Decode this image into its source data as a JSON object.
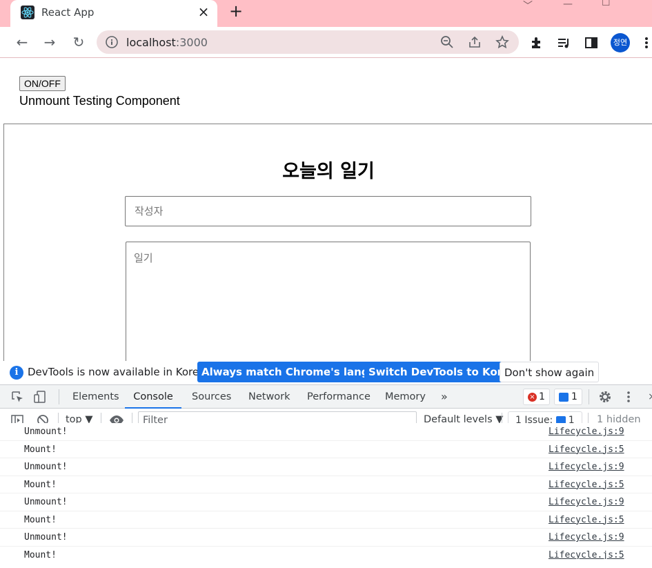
{
  "browser": {
    "tab_title": "React App",
    "url_host": "localhost",
    "url_port": ":3000",
    "profile_initials": "정연"
  },
  "page": {
    "toggle_button": "ON/OFF",
    "unmount_text": "Unmount Testing Component",
    "diary_title": "오늘의 일기",
    "author_placeholder": "작성자",
    "content_placeholder": "일기"
  },
  "infobar": {
    "message": "DevTools is now available in Korean!",
    "btn_match": "Always match Chrome's language",
    "btn_switch": "Switch DevTools to Korean",
    "btn_dismiss": "Don't show again"
  },
  "devtools": {
    "tabs": [
      "Elements",
      "Console",
      "Sources",
      "Network",
      "Performance",
      "Memory"
    ],
    "active_tab": "Console",
    "error_count": "1",
    "message_count": "1",
    "context": "top",
    "filter_placeholder": "Filter",
    "levels": "Default levels",
    "issues": "1 Issue:",
    "issues_count": "1",
    "hidden": "1 hidden"
  },
  "console_logs": [
    {
      "text": "Unmount!",
      "source": "Lifecycle.js:9"
    },
    {
      "text": "Mount!",
      "source": "Lifecycle.js:5"
    },
    {
      "text": "Unmount!",
      "source": "Lifecycle.js:9"
    },
    {
      "text": "Mount!",
      "source": "Lifecycle.js:5"
    },
    {
      "text": "Unmount!",
      "source": "Lifecycle.js:9"
    },
    {
      "text": "Mount!",
      "source": "Lifecycle.js:5"
    },
    {
      "text": "Unmount!",
      "source": "Lifecycle.js:9"
    },
    {
      "text": "Mount!",
      "source": "Lifecycle.js:5"
    }
  ],
  "colors": {
    "tabstrip": "#ffbfc6",
    "accent": "#1a73e8",
    "error": "#d93025"
  }
}
